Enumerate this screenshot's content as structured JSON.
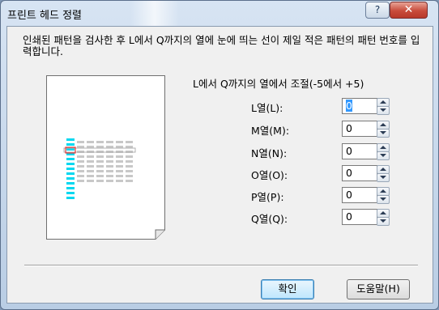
{
  "window": {
    "title": "프린트 헤드 정렬",
    "help_glyph": "?",
    "close_glyph": "✕"
  },
  "instruction": "인쇄된 패턴을 검사한 후 L에서 Q까지의 열에 눈에 띄는 선이 제일 적은 패턴의 패턴 번호를 입력합니다.",
  "range_label": "L에서 Q까지의 열에서 조절(-5에서 +5)",
  "rows": [
    {
      "label": "L열(L):",
      "value": "0",
      "focused": true
    },
    {
      "label": "M열(M):",
      "value": "0"
    },
    {
      "label": "N열(N):",
      "value": "0"
    },
    {
      "label": "O열(O):",
      "value": "0"
    },
    {
      "label": "P열(P):",
      "value": "0"
    },
    {
      "label": "Q열(Q):",
      "value": "0"
    }
  ],
  "buttons": {
    "ok": "확인",
    "help": "도움말(H)"
  },
  "colors": {
    "cyan_bars": "#00d8f0",
    "gray_bars": "#c8c8c8",
    "highlight": "#e23a3a"
  },
  "icons": [
    "help-icon",
    "close-icon",
    "spin-up-icon",
    "spin-down-icon"
  ]
}
